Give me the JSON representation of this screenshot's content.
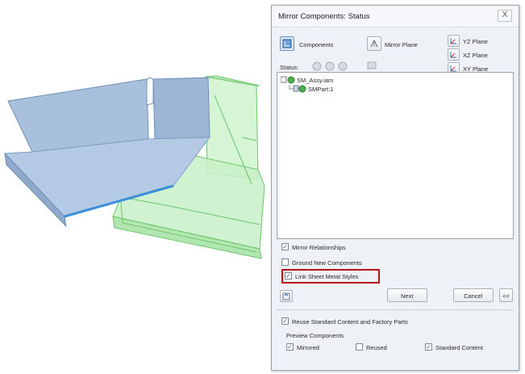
{
  "dialog": {
    "title": "Mirror Components: Status",
    "close_label": "X",
    "components_label": "Components",
    "mirror_plane_label": "Mirror Plane",
    "status_label": "Status:",
    "planes": [
      "YZ Plane",
      "XZ Plane",
      "XY Plane"
    ],
    "tree": [
      {
        "label": "SM_Assy.iam",
        "level": 0
      },
      {
        "label": "SMPart:1",
        "level": 1
      }
    ],
    "options": [
      {
        "label": "Mirror Relationships",
        "checked": true
      },
      {
        "label": "Ground New Components",
        "checked": false
      },
      {
        "label": "Link Sheet Metal Styles",
        "checked": true
      }
    ],
    "next_label": "Next",
    "cancel_label": "Cancel",
    "collapse_label": "<<",
    "reuse_label": "Reuse Standard Content and Factory Parts",
    "preview_heading": "Preview Components",
    "preview": [
      {
        "label": "Mirrored",
        "checked": true
      },
      {
        "label": "Reused",
        "checked": false
      },
      {
        "label": "Standard Content",
        "checked": true
      }
    ]
  },
  "colors": {
    "part_blue": "#9db6d6",
    "part_blue_dark": "#7f9fc6",
    "mirror_green": "#c8f0c8",
    "mirror_green_edge": "#6cc46c",
    "bend_line": "#3b8fd9",
    "highlight": "#b3171b"
  },
  "icons": {
    "components": "components-icon",
    "mirror_plane": "mirror-plane-icon",
    "plane": "plane-icon",
    "status": "status-icon",
    "assembly": "assembly-icon",
    "part": "part-icon"
  }
}
